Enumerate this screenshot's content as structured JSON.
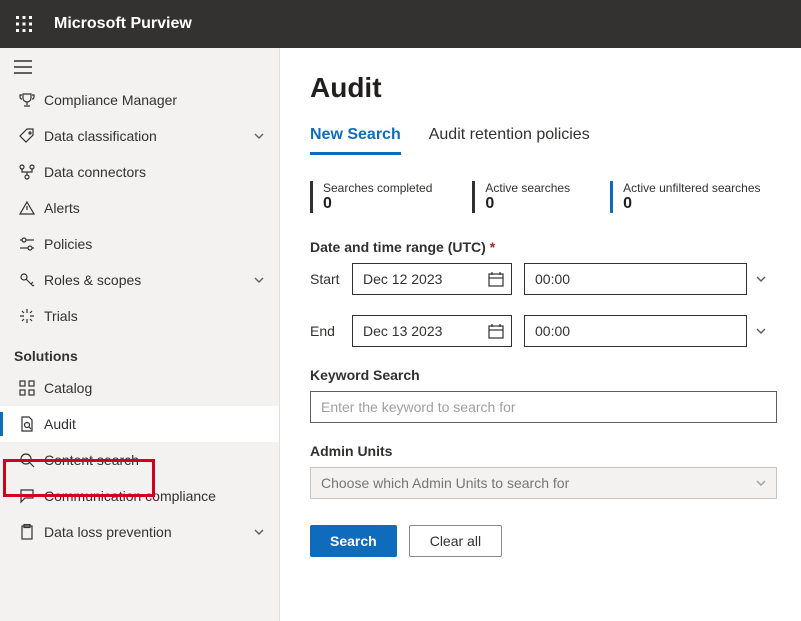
{
  "header": {
    "app_name": "Microsoft Purview"
  },
  "sidebar": {
    "items": [
      {
        "label": "Compliance Manager",
        "icon": "trophy",
        "expandable": false
      },
      {
        "label": "Data classification",
        "icon": "tag",
        "expandable": true
      },
      {
        "label": "Data connectors",
        "icon": "connector",
        "expandable": false
      },
      {
        "label": "Alerts",
        "icon": "warn",
        "expandable": false
      },
      {
        "label": "Policies",
        "icon": "sliders",
        "expandable": false
      },
      {
        "label": "Roles & scopes",
        "icon": "key",
        "expandable": true
      },
      {
        "label": "Trials",
        "icon": "sparkle",
        "expandable": false
      }
    ],
    "section_heading": "Solutions",
    "solutions": [
      {
        "label": "Catalog",
        "icon": "grid"
      },
      {
        "label": "Audit",
        "icon": "doc-search",
        "active": true
      },
      {
        "label": "Content search",
        "icon": "search"
      },
      {
        "label": "Communication compliance",
        "icon": "chat"
      },
      {
        "label": "Data loss prevention",
        "icon": "clipboard",
        "expandable": true
      }
    ]
  },
  "page": {
    "title": "Audit",
    "tabs": [
      {
        "label": "New Search",
        "active": true
      },
      {
        "label": "Audit retention policies",
        "active": false
      }
    ],
    "stats": [
      {
        "label": "Searches completed",
        "value": "0",
        "accent": "dark"
      },
      {
        "label": "Active searches",
        "value": "0",
        "accent": "dark"
      },
      {
        "label": "Active unfiltered searches",
        "value": "0",
        "accent": "blue"
      }
    ],
    "date_range": {
      "heading": "Date and time range (UTC)",
      "required_marker": "*",
      "start_label": "Start",
      "start_date": "Dec 12 2023",
      "start_time": "00:00",
      "end_label": "End",
      "end_date": "Dec 13 2023",
      "end_time": "00:00"
    },
    "keyword": {
      "heading": "Keyword Search",
      "placeholder": "Enter the keyword to search for",
      "value": ""
    },
    "admin_units": {
      "heading": "Admin Units",
      "placeholder": "Choose which Admin Units to search for"
    },
    "buttons": {
      "search": "Search",
      "clear": "Clear all"
    }
  }
}
